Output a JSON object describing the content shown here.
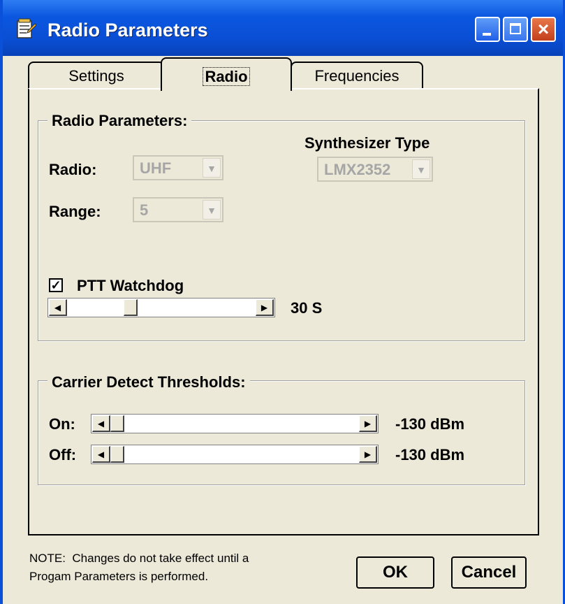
{
  "window": {
    "title": "Radio Parameters",
    "close_glyph": "×"
  },
  "tabs": [
    {
      "label": "Settings",
      "active": false
    },
    {
      "label": "Radio",
      "active": true
    },
    {
      "label": "Frequencies",
      "active": false
    }
  ],
  "radio_group": {
    "title": "Radio Parameters:",
    "radio_label": "Radio:",
    "radio_value": "UHF",
    "range_label": "Range:",
    "range_value": "5",
    "synth_label": "Synthesizer Type",
    "synth_value": "LMX2352",
    "ptt_label": "PTT Watchdog",
    "ptt_checked": true,
    "ptt_check_glyph": "✓",
    "ptt_value": "30 S",
    "ptt_slider_fraction": 0.32
  },
  "carrier_group": {
    "title": "Carrier Detect Thresholds:",
    "on_label": "On:",
    "on_value": "-130 dBm",
    "on_slider_fraction": 0.0,
    "off_label": "Off:",
    "off_value": "-130 dBm",
    "off_slider_fraction": 0.0
  },
  "scroll_glyphs": {
    "left": "◀",
    "right": "▶",
    "dropdown": "▼"
  },
  "note": "NOTE:  Changes do not take effect until a\nProgam Parameters is performed.",
  "buttons": {
    "ok": "OK",
    "cancel": "Cancel"
  }
}
